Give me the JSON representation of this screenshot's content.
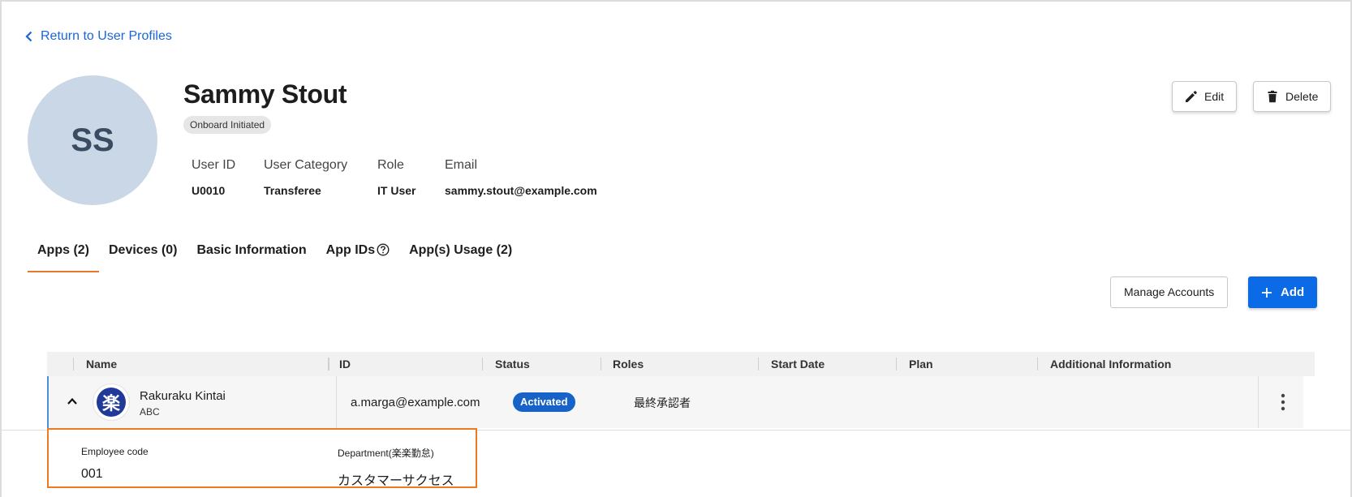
{
  "nav": {
    "back_label": "Return to User Profiles"
  },
  "profile": {
    "initials": "SS",
    "name": "Sammy Stout",
    "status": "Onboard Initiated",
    "fields": [
      {
        "label": "User ID",
        "value": "U0010"
      },
      {
        "label": "User Category",
        "value": "Transferee"
      },
      {
        "label": "Role",
        "value": "IT User"
      },
      {
        "label": "Email",
        "value": "sammy.stout@example.com"
      }
    ]
  },
  "actions": {
    "edit_label": "Edit",
    "delete_label": "Delete"
  },
  "tabs": [
    {
      "label": "Apps (2)",
      "active": true
    },
    {
      "label": "Devices (0)",
      "active": false
    },
    {
      "label": "Basic Information",
      "active": false
    },
    {
      "label": "App IDs",
      "active": false
    },
    {
      "label": "App(s) Usage (2)",
      "active": false
    }
  ],
  "toolbar": {
    "manage_label": "Manage Accounts",
    "add_label": "Add"
  },
  "table": {
    "columns": [
      "Name",
      "ID",
      "Status",
      "Roles",
      "Start Date",
      "Plan",
      "Additional Information"
    ],
    "rows": [
      {
        "logo_glyph": "楽",
        "name": "Rakuraku Kintai",
        "sub": "ABC",
        "id": "a.marga@example.com",
        "status": "Activated",
        "roles": "最終承認者"
      }
    ]
  },
  "detail": {
    "fields": [
      {
        "label": "Employee code",
        "value": "001"
      },
      {
        "label": "Department(楽楽勤怠)",
        "value": "カスタマーサクセス"
      }
    ]
  },
  "colors": {
    "accent": "#0b6ae6",
    "tab_indicator": "#e7792b",
    "highlight_border": "#ee7a22",
    "status_pill": "#1662c8"
  }
}
